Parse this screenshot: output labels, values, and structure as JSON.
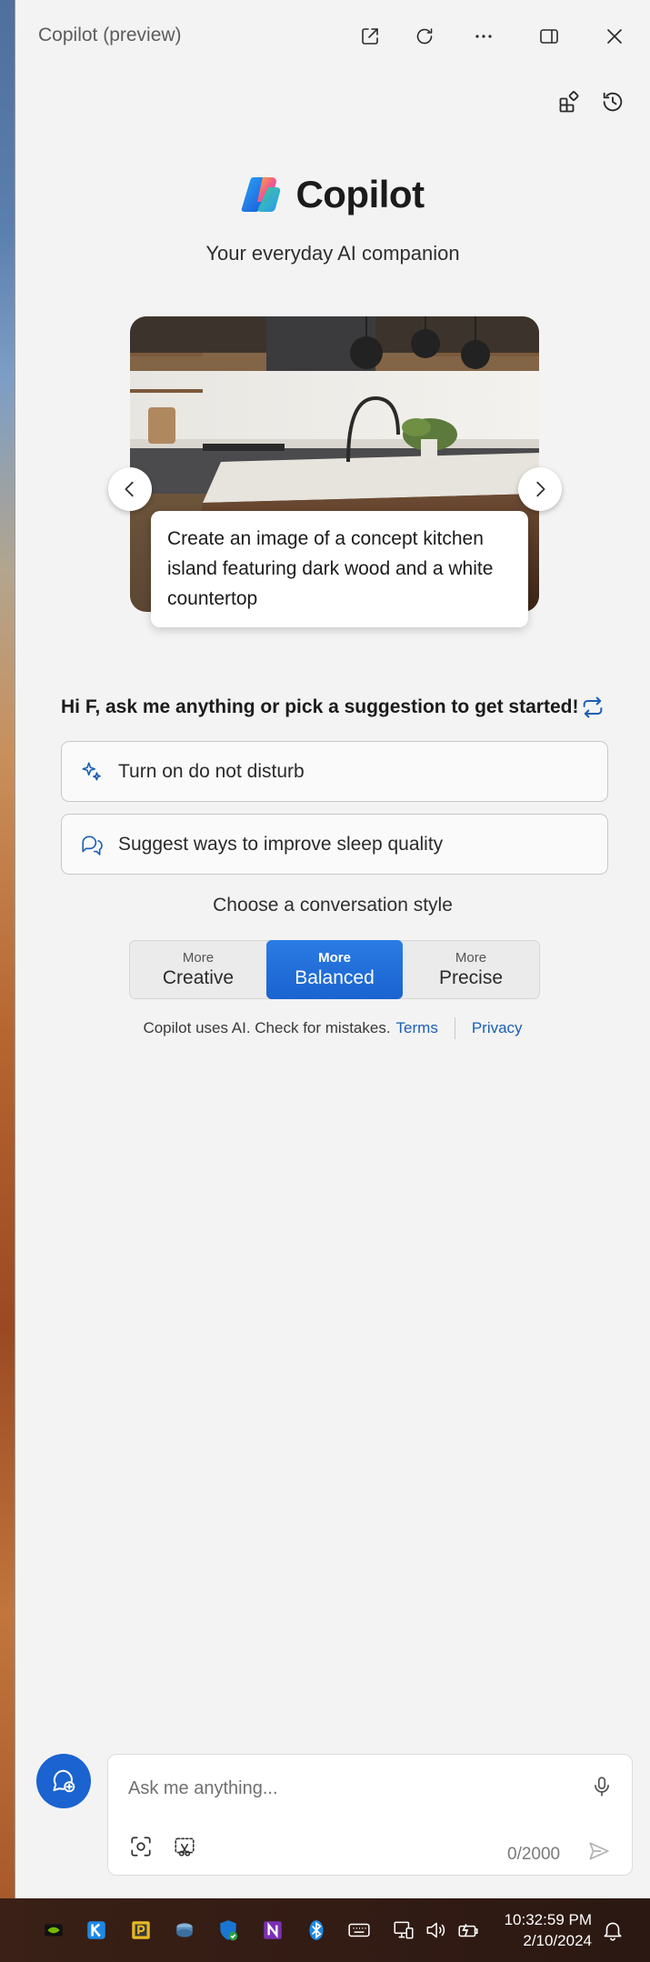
{
  "window": {
    "title": "Copilot (preview)",
    "buttons": {
      "open_external": "open-in-new-window-icon",
      "refresh": "refresh-icon",
      "more": "more-options-icon",
      "dock": "dock-sidebar-icon",
      "close": "close-icon"
    }
  },
  "toolbar": {
    "plugins": "plugins-icon",
    "history": "history-icon"
  },
  "header": {
    "brand": "Copilot",
    "tagline": "Your everyday AI companion"
  },
  "carousel": {
    "caption": "Create an image of a concept kitchen island featuring dark wood and a white countertop"
  },
  "greeting": "Hi F, ask me anything or pick a suggestion to get started!",
  "suggestions": [
    {
      "label": "Turn on do not disturb",
      "icon": "sparkle-icon"
    },
    {
      "label": "Suggest ways to improve sleep quality",
      "icon": "chat-bubbles-icon"
    }
  ],
  "conversation_style": {
    "heading": "Choose a conversation style",
    "options": [
      {
        "small": "More",
        "large": "Creative"
      },
      {
        "small": "More",
        "large": "Balanced"
      },
      {
        "small": "More",
        "large": "Precise"
      }
    ],
    "selected": "Balanced"
  },
  "disclaimer": {
    "text": "Copilot uses AI. Check for mistakes.",
    "terms": "Terms",
    "privacy": "Privacy"
  },
  "composer": {
    "placeholder": "Ask me anything...",
    "counter": "0/2000"
  },
  "taskbar": {
    "time": "10:32:59 PM",
    "date": "2/10/2024"
  },
  "colors": {
    "accent": "#1a63d0",
    "background": "#f3f3f3",
    "link": "#1a5fb4"
  }
}
